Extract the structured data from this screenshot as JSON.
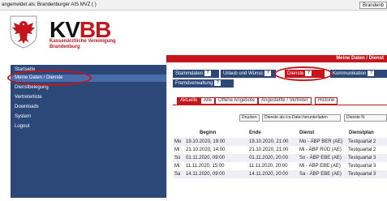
{
  "topbar": {
    "login_text": "angemeldet als: Brandenburger AIS MVZ ( )",
    "brand_button": "Brandenb"
  },
  "header": {
    "logo_main": "KV",
    "logo_accent": "BB",
    "logo_sub1": "Kassenärztliche Vereinigung",
    "logo_sub2": "Brandenburg"
  },
  "breadcrumb": "Meine Daten / Dienst",
  "sidebar": {
    "items": [
      {
        "label": "Startseite"
      },
      {
        "label": "Meine Daten / Dienste"
      },
      {
        "label": "Dienstbelegung"
      },
      {
        "label": "Vertreterliste"
      },
      {
        "label": "Downloads"
      },
      {
        "label": "System"
      },
      {
        "label": "Logout"
      }
    ]
  },
  "tabs": [
    {
      "label": "Stammdaten",
      "q": "?"
    },
    {
      "label": "Urlaub und Wünsc",
      "q": "?"
    },
    {
      "label": "Dienste",
      "q": "?"
    },
    {
      "label": "Kommunikation",
      "q": "?"
    },
    {
      "label": "Fremdverwaltung",
      "q": "?"
    }
  ],
  "subtabs": [
    {
      "label": "Aktuelle"
    },
    {
      "label": "Alle"
    },
    {
      "label": "Offene Angebote"
    },
    {
      "label": "Angestellte / Vertreter"
    },
    {
      "label": "Historie"
    }
  ],
  "buttons": {
    "print": "Drucken",
    "download": "Dienste als ics-Datei herunterladen",
    "other": "Dienste N"
  },
  "table": {
    "headers": [
      "Beginn",
      "Ende",
      "Dienst",
      "Dienstplan"
    ],
    "rows": [
      {
        "day": "Mo",
        "begin": "19.10.2020, 19:00",
        "end": "19.10.2020, 21:00",
        "service": "Mo - ÄBP BER (AE)",
        "plan": "Testquartal 2"
      },
      {
        "day": "Mi",
        "begin": "21.10.2020, 14:00",
        "end": "21.10.2020, 21:00",
        "service": "Mi - ÄBP RÜD (AE)",
        "plan": "Testquartal 2"
      },
      {
        "day": "So",
        "begin": "01.11.2020, 09:00",
        "end": "01.11.2020, 20:00",
        "service": "So - ÄBP EBE (AE)",
        "plan": "Testquartal 3"
      },
      {
        "day": "Mi",
        "begin": "11.11.2020, 15:00",
        "end": "11.11.2020, 20:00",
        "service": "Mi - ÄBP EBE (AE)",
        "plan": "Testquartal 3"
      },
      {
        "day": "Sa",
        "begin": "14.11.2020, 09:00",
        "end": "14.11.2020, 20:00",
        "service": "Sa - ÄBP EBE (AE)",
        "plan": "Testquartal 3"
      }
    ]
  },
  "colors": {
    "brand_red": "#c4161c",
    "nav_blue": "#2b4879",
    "nav_active": "#4a6cad"
  }
}
